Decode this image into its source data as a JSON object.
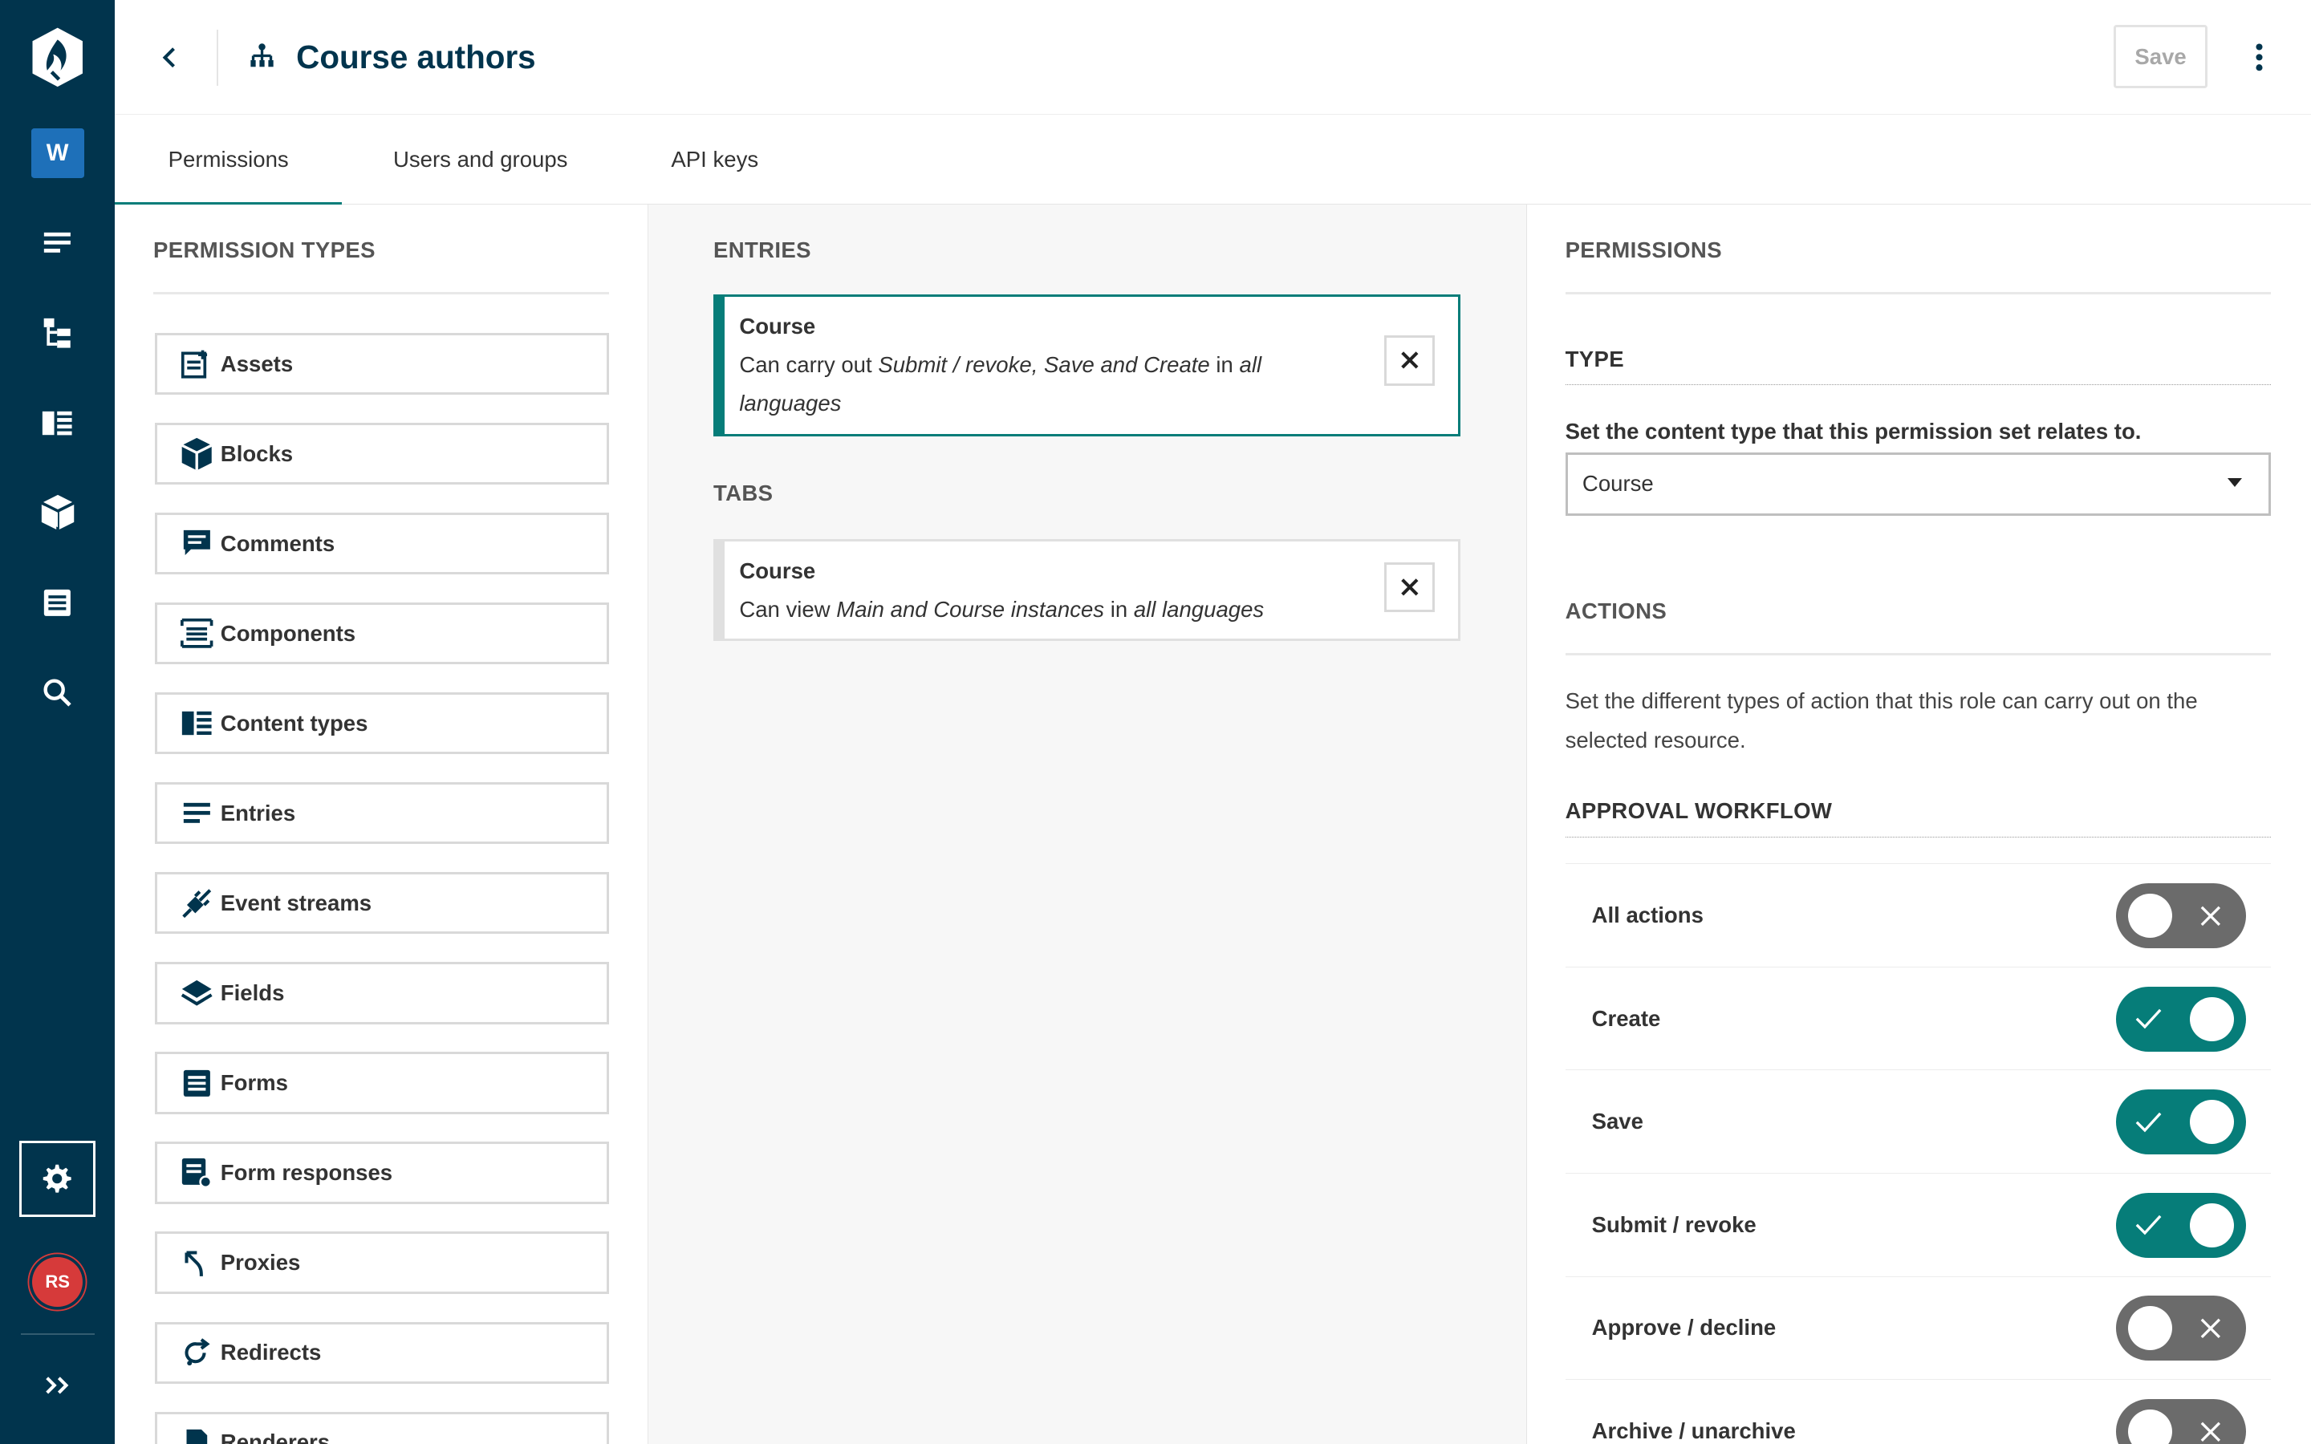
{
  "header": {
    "title": "Course authors",
    "save_label": "Save"
  },
  "rail": {
    "workspace_initial": "W",
    "user_initials": "RS",
    "icons": [
      "logo-icon",
      "entries-icon",
      "site-tree-icon",
      "content-types-icon",
      "blocks-icon",
      "forms-icon",
      "search-icon",
      "settings-icon",
      "expand-icon"
    ]
  },
  "tabs": [
    {
      "label": "Permissions",
      "active": true
    },
    {
      "label": "Users and groups",
      "active": false
    },
    {
      "label": "API keys",
      "active": false
    }
  ],
  "permission_types": {
    "title": "PERMISSION TYPES",
    "items": [
      {
        "label": "Assets",
        "icon": "assets-icon"
      },
      {
        "label": "Blocks",
        "icon": "blocks-icon"
      },
      {
        "label": "Comments",
        "icon": "comments-icon"
      },
      {
        "label": "Components",
        "icon": "components-icon"
      },
      {
        "label": "Content types",
        "icon": "content-types-icon"
      },
      {
        "label": "Entries",
        "icon": "entries-icon"
      },
      {
        "label": "Event streams",
        "icon": "event-streams-icon"
      },
      {
        "label": "Fields",
        "icon": "fields-icon"
      },
      {
        "label": "Forms",
        "icon": "forms-icon"
      },
      {
        "label": "Form responses",
        "icon": "form-responses-icon"
      },
      {
        "label": "Proxies",
        "icon": "proxies-icon"
      },
      {
        "label": "Redirects",
        "icon": "redirects-icon"
      },
      {
        "label": "Renderers",
        "icon": "renderers-icon"
      }
    ]
  },
  "entries": {
    "title": "ENTRIES",
    "card": {
      "title": "Course",
      "prefix": "Can carry out ",
      "actions": "Submit / revoke, Save and Create",
      "mid": " in ",
      "languages_a": "all",
      "languages_b": "languages"
    }
  },
  "tabs_section": {
    "title": "TABS",
    "card": {
      "title": "Course",
      "prefix": "Can view ",
      "tabs": "Main and Course instances",
      "mid": " in ",
      "languages": "all languages"
    }
  },
  "permissions": {
    "title": "PERMISSIONS",
    "type_title": "TYPE",
    "type_label": "Set the content type that this permission set relates to.",
    "type_value": "Course",
    "actions_title": "ACTIONS",
    "actions_desc": "Set the different types of action that this role can carry out on the selected resource.",
    "workflow_title": "APPROVAL WORKFLOW",
    "workflow": [
      {
        "label": "All actions",
        "on": false
      },
      {
        "label": "Create",
        "on": true
      },
      {
        "label": "Save",
        "on": true
      },
      {
        "label": "Submit / revoke",
        "on": true
      },
      {
        "label": "Approve / decline",
        "on": false
      },
      {
        "label": "Archive / unarchive",
        "on": false
      }
    ]
  },
  "colors": {
    "rail": "#01344d",
    "accent": "#067d79",
    "toggle_off": "#6b6b6b",
    "avatar": "#d63a3a",
    "workspace": "#1e70b9"
  }
}
